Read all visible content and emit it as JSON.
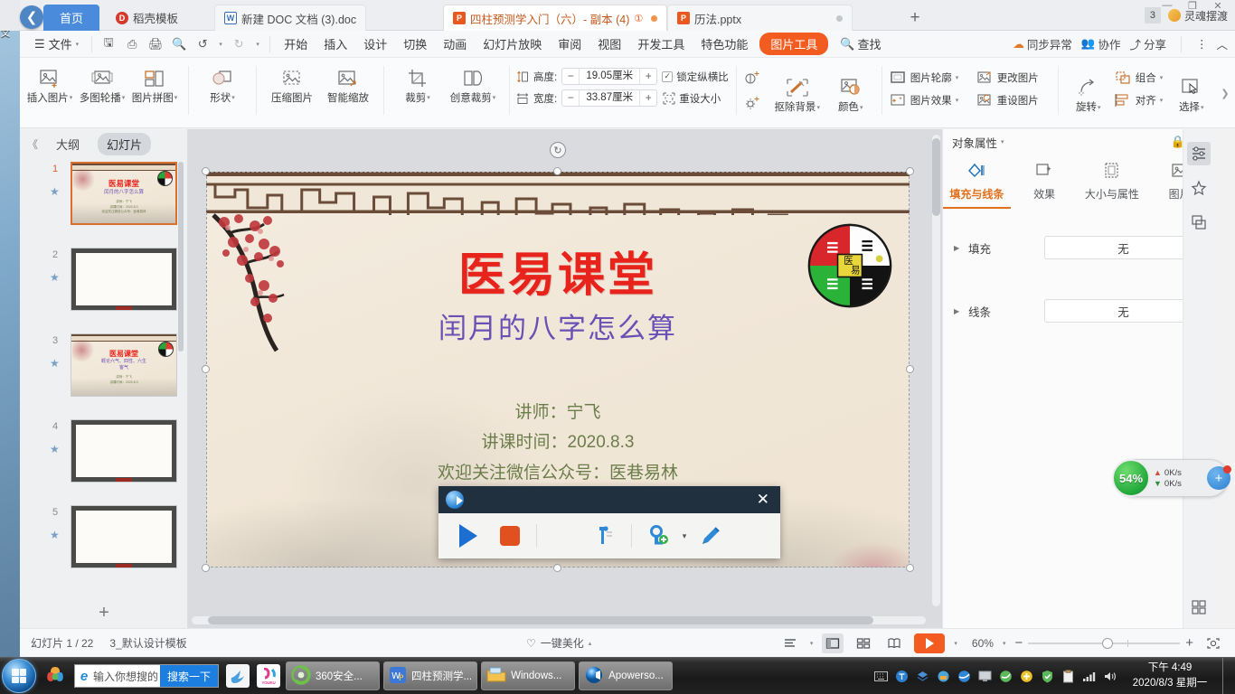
{
  "window": {
    "tabs": [
      {
        "label": "首页",
        "icon": "home-icon",
        "type": "home"
      },
      {
        "label": "稻壳模板",
        "icon": "docer-icon",
        "type": "docer"
      },
      {
        "label": "新建 DOC 文档 (3).doc",
        "icon": "word-icon",
        "type": "doc"
      },
      {
        "label": "四柱预测学入门（六）- 副本 (4)",
        "icon": "ppt-icon",
        "type": "ppt",
        "warn": "①",
        "active": true
      },
      {
        "label": "历法.pptx",
        "icon": "ppt-icon",
        "type": "ppt"
      }
    ],
    "new_tab": "+",
    "badge_count": "3",
    "soul_label": "灵魂摆渡",
    "min": "—",
    "max": "❐",
    "close": "✕"
  },
  "menu": {
    "file": "文件",
    "quick": [
      "save-icon",
      "print-preview-icon",
      "print-icon",
      "search-doc-icon",
      "undo-icon",
      "redo-icon",
      "customize-icon"
    ],
    "items": [
      "开始",
      "插入",
      "设计",
      "切换",
      "动画",
      "幻灯片放映",
      "审阅",
      "视图",
      "开发工具",
      "特色功能"
    ],
    "highlight_tab": "图片工具",
    "find": "查找",
    "right": [
      {
        "label": "同步异常",
        "icon": "sync-warning-icon"
      },
      {
        "label": "协作",
        "icon": "collaborate-icon"
      },
      {
        "label": "分享",
        "icon": "share-icon"
      }
    ],
    "more": "⋮",
    "collapse": "︿"
  },
  "ribbon": {
    "buttons_left": [
      {
        "label": "插入图片",
        "icon": "insert-picture-icon",
        "caret": true
      },
      {
        "label": "多图轮播",
        "icon": "multi-image-carousel-icon",
        "caret": true
      },
      {
        "label": "图片拼图",
        "icon": "picture-collage-icon",
        "caret": true
      },
      {
        "label": "形状",
        "icon": "shapes-icon",
        "caret": true
      },
      {
        "label": "压缩图片",
        "icon": "compress-picture-icon",
        "caret": false
      },
      {
        "label": "智能缩放",
        "icon": "smart-scale-icon",
        "caret": false
      },
      {
        "label": "裁剪",
        "icon": "crop-icon",
        "caret": true
      },
      {
        "label": "创意裁剪",
        "icon": "creative-crop-icon",
        "caret": true
      }
    ],
    "size": {
      "height_label": "高度:",
      "height_value": "19.05厘米",
      "width_label": "宽度:",
      "width_value": "33.87厘米",
      "lock_ratio": "锁定纵横比",
      "lock_checked": true,
      "reset_size": "重设大小",
      "minus": "−",
      "plus": "+"
    },
    "adjust": [
      {
        "label": "抠除背景",
        "icon": "remove-background-icon",
        "caret": true
      },
      {
        "label": "颜色",
        "icon": "color-icon",
        "caret": true
      }
    ],
    "brightness_icons": [
      "brightness-increase-icon",
      "contrast-increase-icon"
    ],
    "styles": [
      {
        "label": "图片轮廓",
        "icon": "picture-outline-icon",
        "caret": true
      },
      {
        "label": "图片效果",
        "icon": "picture-effects-icon",
        "caret": true
      },
      {
        "label": "更改图片",
        "icon": "change-picture-icon",
        "caret": false
      },
      {
        "label": "重设图片",
        "icon": "reset-picture-icon",
        "caret": false
      }
    ],
    "arrange": [
      {
        "label": "旋转",
        "icon": "rotate-icon",
        "caret": true
      },
      {
        "label": "组合",
        "icon": "group-icon",
        "caret": true
      },
      {
        "label": "对齐",
        "icon": "align-icon",
        "caret": true
      },
      {
        "label": "选择",
        "icon": "select-icon",
        "caret": true
      }
    ]
  },
  "sidebar": {
    "collapse": "《",
    "tab_outline": "大纲",
    "tab_slides": "幻灯片",
    "active_tab": "幻灯片",
    "add_slide": "+",
    "thumbs": [
      {
        "num": "1",
        "star": "★",
        "selected": true,
        "kind": "title"
      },
      {
        "num": "2",
        "star": "★",
        "selected": false,
        "kind": "blank"
      },
      {
        "num": "3",
        "star": "★",
        "selected": false,
        "kind": "content"
      },
      {
        "num": "4",
        "star": "★",
        "selected": false,
        "kind": "blank"
      },
      {
        "num": "5",
        "star": "★",
        "selected": false,
        "kind": "blank"
      }
    ],
    "thumb_title": "医易课堂",
    "thumb_sub1": "闰月的八字怎么算",
    "thumb_sub3": "概论六气、四性、六生客气"
  },
  "slide": {
    "title": "医易课堂",
    "subtitle": "闰月的八字怎么算",
    "lines": [
      "讲师：宁飞",
      "讲课时间：2020.8.3",
      "欢迎关注微信公众号：医巷易林"
    ],
    "taiji_center_left": "医",
    "taiji_center_right": "易"
  },
  "recorder": {
    "title_icon": "apowersoft-recorder-icon",
    "close": "✕",
    "buttons": [
      {
        "name": "record-start-button",
        "icon": "play-icon"
      },
      {
        "name": "record-stop-button",
        "icon": "stop-icon"
      },
      {
        "name": "annotation-tool-button",
        "icon": "marker-pin-icon"
      },
      {
        "name": "add-watermark-button",
        "icon": "add-target-icon",
        "caret": true
      },
      {
        "name": "pen-tool-button",
        "icon": "pencil-icon"
      }
    ]
  },
  "rightpanel": {
    "title": "对象属性",
    "lock_icon": "lock-icon",
    "close_icon": "close-icon",
    "tabs": [
      {
        "label": "填充与线条",
        "icon": "fill-line-icon",
        "active": true
      },
      {
        "label": "效果",
        "icon": "effects-icon",
        "active": false
      },
      {
        "label": "大小与属性",
        "icon": "size-properties-icon",
        "active": false
      },
      {
        "label": "图片",
        "icon": "picture-icon",
        "active": false
      }
    ],
    "rows": [
      {
        "label": "填充",
        "value": "无"
      },
      {
        "label": "线条",
        "value": "无"
      }
    ],
    "rail": [
      {
        "icon": "properties-panel-icon",
        "active": true
      },
      {
        "icon": "animation-star-icon",
        "active": false
      },
      {
        "icon": "selection-pane-icon",
        "active": false
      }
    ],
    "rail_bottom_icon": "grid-icon"
  },
  "netfloat": {
    "percent": "54%",
    "upload": "0K/s",
    "download": "0K/s",
    "plus": "+"
  },
  "statusbar": {
    "slide_counter": "幻灯片 1 / 22",
    "template": "3_默认设计模板",
    "beautify": "一键美化",
    "views": [
      "outline-view-icon",
      "normal-view-icon",
      "slide-sorter-icon",
      "reading-view-icon"
    ],
    "active_view": "normal-view-icon",
    "play": "play-icon",
    "zoom": "60%",
    "zoom_out": "−",
    "zoom_in": "+",
    "fit": "fit-icon"
  },
  "taskbar": {
    "start": "start-orb-icon",
    "pinned": [
      "kingsoft-icon"
    ],
    "search_placeholder": "输入你想搜的",
    "search_button": "搜索一下",
    "quicklaunch": [
      "bird-icon",
      "youku-icon"
    ],
    "tasks": [
      {
        "label": "360安全...",
        "icon": "360-icon"
      },
      {
        "label": "四柱预测学...",
        "icon": "wps-ppt-icon"
      },
      {
        "label": "Windows...",
        "icon": "explorer-icon"
      },
      {
        "label": "Apowerso...",
        "icon": "apowersoft-icon"
      }
    ],
    "tray": [
      "keyboard-icon",
      "ime-icon",
      "layers-icon",
      "guard-icon",
      "browser-icon",
      "screen-icon",
      "green-icon",
      "plus-icon",
      "shield-icon",
      "clipboard-icon",
      "network-icon",
      "volume-icon"
    ],
    "time": "下午 4:49",
    "date": "2020/8/3 星期一"
  }
}
